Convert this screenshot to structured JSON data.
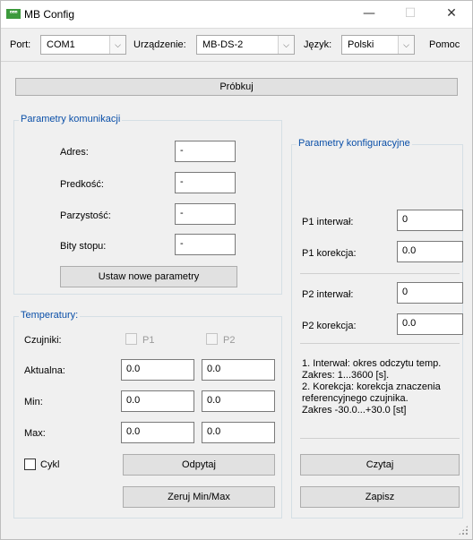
{
  "window": {
    "title": "MB Config",
    "icon_text": "ᴮᴮᴮ",
    "minimize_glyph": "—",
    "maximize_glyph": "☐",
    "close_glyph": "✕"
  },
  "toolbar": {
    "port_label": "Port:",
    "port_value": "COM1",
    "device_label": "Urządzenie:",
    "device_value": "MB-DS-2",
    "language_label": "Język:",
    "language_value": "Polski",
    "help_label": "Pomoc",
    "dropdown_glyph": "⌵"
  },
  "probe_button": "Próbkuj",
  "communication": {
    "title": "Parametry komunikacji",
    "fields": [
      {
        "label": "Adres:",
        "value": "-"
      },
      {
        "label": "Predkość:",
        "value": "-"
      },
      {
        "label": "Parzystość:",
        "value": "-"
      },
      {
        "label": "Bity stopu:",
        "value": "-"
      }
    ],
    "set_button": "Ustaw nowe parametry"
  },
  "temperatures": {
    "title": "Temperatury:",
    "sensors_label": "Czujniki:",
    "sensor1": "P1",
    "sensor2": "P2",
    "rows": [
      {
        "label": "Aktualna:",
        "p1": "0.0",
        "p2": "0.0"
      },
      {
        "label": "Min:",
        "p1": "0.0",
        "p2": "0.0"
      },
      {
        "label": "Max:",
        "p1": "0.0",
        "p2": "0.0"
      }
    ],
    "cycle_label": "Cykl",
    "query_button": "Odpytaj",
    "reset_button": "Zeruj Min/Max"
  },
  "configuration": {
    "title": "Parametry konfiguracyjne",
    "p1_interval_label": "P1 interwał:",
    "p1_interval_value": "0",
    "p1_correction_label": "P1 korekcja:",
    "p1_correction_value": "0.0",
    "p2_interval_label": "P2 interwał:",
    "p2_interval_value": "0",
    "p2_correction_label": "P2 korekcja:",
    "p2_correction_value": "0.0",
    "notes": [
      "1. Interwał:  okres odczytu temp.",
      "Zakres: 1...3600 [s].",
      "2. Korekcja: korekcja znaczenia",
      "referencyjnego czujnika.",
      "Zakres -30.0...+30.0 [st]"
    ],
    "read_button": "Czytaj",
    "save_button": "Zapisz"
  }
}
